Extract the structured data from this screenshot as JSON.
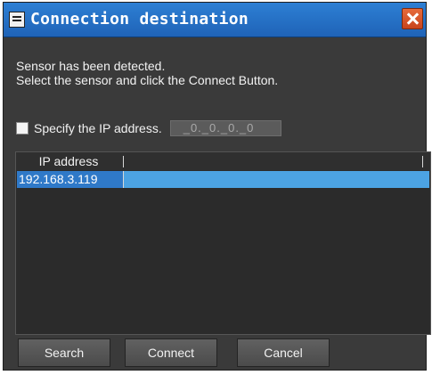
{
  "dialog": {
    "title": "Connection destination",
    "message_line1": "Sensor has been detected.",
    "message_line2": "Select the sensor and click the Connect Button."
  },
  "ip_option": {
    "label": "Specify the IP address.",
    "checked": false,
    "value": "_0._0._0._0"
  },
  "list": {
    "columns": [
      "IP address"
    ],
    "rows": [
      {
        "ip": "192.168.3.119",
        "selected": true
      }
    ]
  },
  "buttons": {
    "search": "Search",
    "connect": "Connect",
    "cancel": "Cancel"
  },
  "colors": {
    "titlebar": "#1f63b7",
    "dialog_bg": "#3a3a3a",
    "selection": "#4ca3e3",
    "close_button": "#c8431d"
  },
  "icons": [
    "app-icon",
    "close-icon"
  ]
}
